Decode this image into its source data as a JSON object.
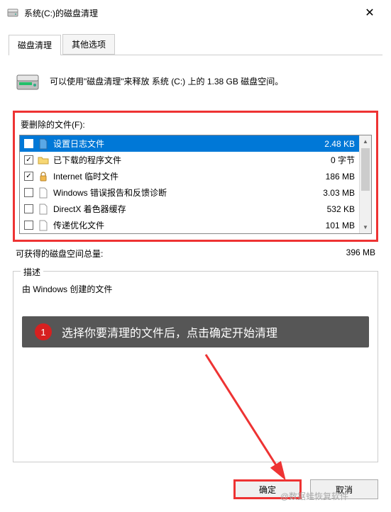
{
  "window": {
    "title": "系统(C:)的磁盘清理"
  },
  "tabs": {
    "active": "磁盘清理",
    "other": "其他选项"
  },
  "intro": {
    "text": "可以使用\"磁盘清理\"来释放 系统 (C:) 上的 1.38 GB 磁盘空间。"
  },
  "filelist": {
    "label": "要删除的文件(F):",
    "items": [
      {
        "checked": false,
        "icon": "page-blue",
        "name": "设置日志文件",
        "size": "2.48 KB",
        "selected": true
      },
      {
        "checked": true,
        "icon": "folder",
        "name": "已下载的程序文件",
        "size": "0 字节",
        "selected": false
      },
      {
        "checked": true,
        "icon": "lock",
        "name": "Internet 临时文件",
        "size": "186 MB",
        "selected": false
      },
      {
        "checked": false,
        "icon": "page",
        "name": "Windows 错误报告和反馈诊断",
        "size": "3.03 MB",
        "selected": false
      },
      {
        "checked": false,
        "icon": "page",
        "name": "DirectX 着色器缓存",
        "size": "532 KB",
        "selected": false
      },
      {
        "checked": false,
        "icon": "page",
        "name": "传递优化文件",
        "size": "101 MB",
        "selected": false
      }
    ]
  },
  "total": {
    "label": "可获得的磁盘空间总量:",
    "value": "396 MB"
  },
  "description": {
    "group_label": "描述",
    "text": "由 Windows 创建的文件"
  },
  "callout": {
    "badge": "1",
    "text": "选择你要清理的文件后，点击确定开始清理"
  },
  "buttons": {
    "ok": "确定",
    "cancel": "取消"
  },
  "watermark": "@数据蛙恢复软件"
}
